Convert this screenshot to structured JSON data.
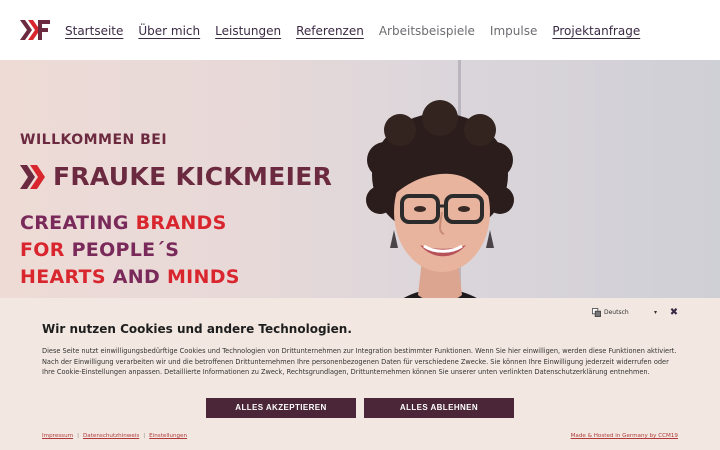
{
  "header": {
    "logo_name": "kf-logo",
    "nav": [
      {
        "label": "Startseite",
        "underline": true
      },
      {
        "label": "Über mich",
        "underline": true
      },
      {
        "label": "Leistungen",
        "underline": true
      },
      {
        "label": "Referenzen",
        "underline": true
      },
      {
        "label": "Arbeitsbeispiele",
        "underline": false
      },
      {
        "label": "Impulse",
        "underline": false
      },
      {
        "label": "Projektanfrage",
        "underline": true
      }
    ]
  },
  "hero": {
    "welcome": "WILLKOMMEN BEI",
    "name": "FRAUKE KICKMEIER",
    "tagline": [
      [
        {
          "text": "CREATING ",
          "color": "purple"
        },
        {
          "text": "BRANDS",
          "color": "red"
        }
      ],
      [
        {
          "text": "FOR ",
          "color": "red"
        },
        {
          "text": "PEOPLE´S",
          "color": "purple"
        }
      ],
      [
        {
          "text": "HEARTS ",
          "color": "red"
        },
        {
          "text": "AND ",
          "color": "purple"
        },
        {
          "text": "MINDS",
          "color": "red"
        }
      ]
    ]
  },
  "cookie": {
    "language": "Deutsch",
    "close_symbol": "✖",
    "title": "Wir nutzen Cookies und andere Technologien.",
    "text": "Diese Seite nutzt einwilligungsbedürftige Cookies und Technologien von Drittunternehmen zur Integration bestimmter Funktionen. Wenn Sie hier einwilligen, werden diese Funktionen aktiviert. Nach der Einwilligung verarbeiten wir und die betroffenen Drittunternehmen Ihre personenbezogenen Daten für verschiedene Zwecke. Sie können Ihre Einwilligung jederzeit widerrufen oder Ihre Cookie-Einstellungen anpassen. Detaillierte Informationen zu Zweck, Rechtsgrundlagen, Drittunternehmen können Sie unserer unten verlinkten Datenschutzerklärung entnehmen.",
    "accept_label": "ALLES AKZEPTIEREN",
    "reject_label": "ALLES ABLEHNEN",
    "links": [
      "Impressum",
      "Datenschutzhinweis",
      "Einstellungen"
    ],
    "made_label": "Made & Hosted in Germany by CCM19"
  },
  "colors": {
    "brand_purple": "#6b2a3f",
    "brand_red": "#d9262e",
    "button_bg": "#4a2638",
    "banner_bg": "#f3e8e1"
  }
}
